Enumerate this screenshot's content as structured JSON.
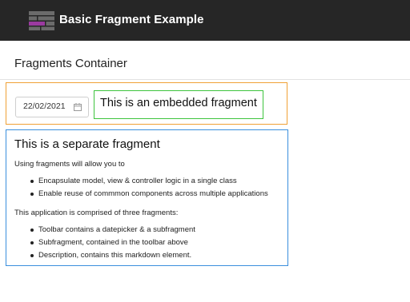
{
  "app": {
    "title": "Basic Fragment Example",
    "logo_icon": "fragment-logo-icon",
    "colors": {
      "appbar": "#262626",
      "logo_accent": "#9b3aa0"
    }
  },
  "container": {
    "title": "Fragments Container"
  },
  "toolbar": {
    "border_color": "#f0a136",
    "datepicker": {
      "value": "22/02/2021",
      "icon": "calendar-icon"
    },
    "subfragment": {
      "text": "This is an embedded fragment",
      "border_color": "#3ec43e"
    }
  },
  "description": {
    "border_color": "#3a8fdd",
    "title": "This is a separate fragment",
    "intro": "Using fragments will allow you to",
    "benefits": [
      "Encapsulate model, view & controller logic in a single class",
      "Enable reuse of commmon components across multiple applications"
    ],
    "comprised_text": "This application is comprised of three fragments:",
    "fragments": [
      "Toolbar contains a datepicker & a subfragment",
      "Subfragment, contained in the toolbar above",
      "Description, contains this markdown element."
    ]
  }
}
